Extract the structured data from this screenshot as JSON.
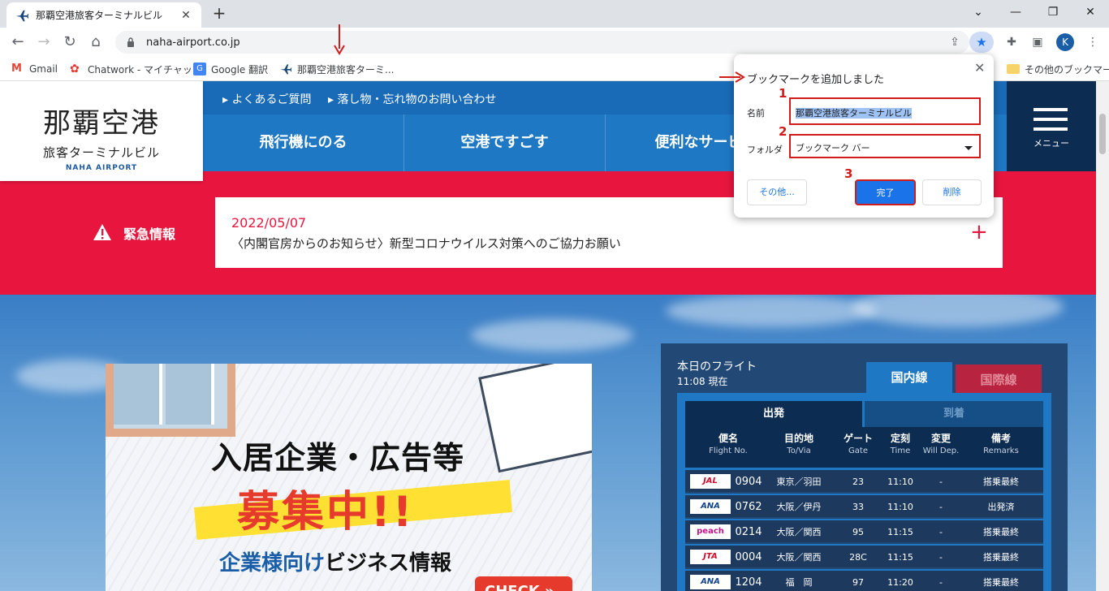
{
  "browser": {
    "tab_title": "那覇空港旅客ターミナルビル",
    "url": "naha-airport.co.jp",
    "profile_initial": "K",
    "bookmarks": [
      {
        "label": "Gmail",
        "icon": "gmail-icon"
      },
      {
        "label": "Chatwork - マイチャット",
        "icon": "chatwork-icon"
      },
      {
        "label": "Google 翻訳",
        "icon": "google-translate-icon"
      },
      {
        "label": "那覇空港旅客ターミ...",
        "icon": "airplane-icon"
      }
    ],
    "other_bookmarks": "その他のブックマーク"
  },
  "bookmark_popup": {
    "title": "ブックマークを追加しました",
    "name_label": "名前",
    "name_value": "那覇空港旅客ターミナルビル",
    "folder_label": "フォルダ",
    "folder_value": "ブックマーク バー",
    "more_button": "その他...",
    "done_button": "完了",
    "delete_button": "削除",
    "steps": [
      "1",
      "2",
      "3"
    ]
  },
  "site": {
    "logo": {
      "line1": "那覇空港",
      "line2": "旅客ターミナルビル",
      "line3": "NAHA AIRPORT"
    },
    "subnav": [
      "よくあるご質問",
      "落し物・忘れ物のお問い合わせ"
    ],
    "mainnav": [
      "飛行機にのる",
      "空港ですごす",
      "便利なサービス"
    ],
    "menu_label": "メニュー",
    "emergency": {
      "title": "緊急情報",
      "date": "2022/05/07",
      "text": "〈内閣官房からのお知らせ〉新型コロナウイルス対策へのご協力お願い"
    },
    "ad": {
      "line1": "入居企業・広告等",
      "line2": "募集中!!",
      "line3_blue": "企業様向け",
      "line3_black": "ビジネス情報",
      "check": "CHECK »"
    },
    "flights": {
      "title": "本日のフライト",
      "status": "11:08 現在",
      "tab_domestic": "国内線",
      "tab_international": "国際線",
      "tab_departure": "出発",
      "tab_arrival": "到着",
      "headers": [
        {
          "ja": "便名",
          "en": "Flight No."
        },
        {
          "ja": "目的地",
          "en": "To/Via"
        },
        {
          "ja": "ゲート",
          "en": "Gate"
        },
        {
          "ja": "定刻",
          "en": "Time"
        },
        {
          "ja": "変更",
          "en": "Will Dep."
        },
        {
          "ja": "備考",
          "en": "Remarks"
        }
      ],
      "rows": [
        {
          "airline": "JAL",
          "flight": "0904",
          "dest": "東京／羽田",
          "gate": "23",
          "time": "11:10",
          "change": "-",
          "remarks": "搭乗最終"
        },
        {
          "airline": "ANA",
          "flight": "0762",
          "dest": "大阪／伊丹",
          "gate": "33",
          "time": "11:10",
          "change": "-",
          "remarks": "出発済"
        },
        {
          "airline": "peach",
          "flight": "0214",
          "dest": "大阪／関西",
          "gate": "95",
          "time": "11:15",
          "change": "-",
          "remarks": "搭乗最終"
        },
        {
          "airline": "JTA",
          "flight": "0004",
          "dest": "大阪／関西",
          "gate": "28C",
          "time": "11:15",
          "change": "-",
          "remarks": "搭乗最終"
        },
        {
          "airline": "ANA",
          "flight": "1204",
          "dest": "福　岡",
          "gate": "97",
          "time": "11:20",
          "change": "-",
          "remarks": "搭乗最終"
        }
      ]
    }
  },
  "colors": {
    "emergency_red": "#e8163f",
    "nav_blue": "#1f78c4",
    "dark_navy": "#0c2c52",
    "annotation_red": "#d21b1b"
  }
}
